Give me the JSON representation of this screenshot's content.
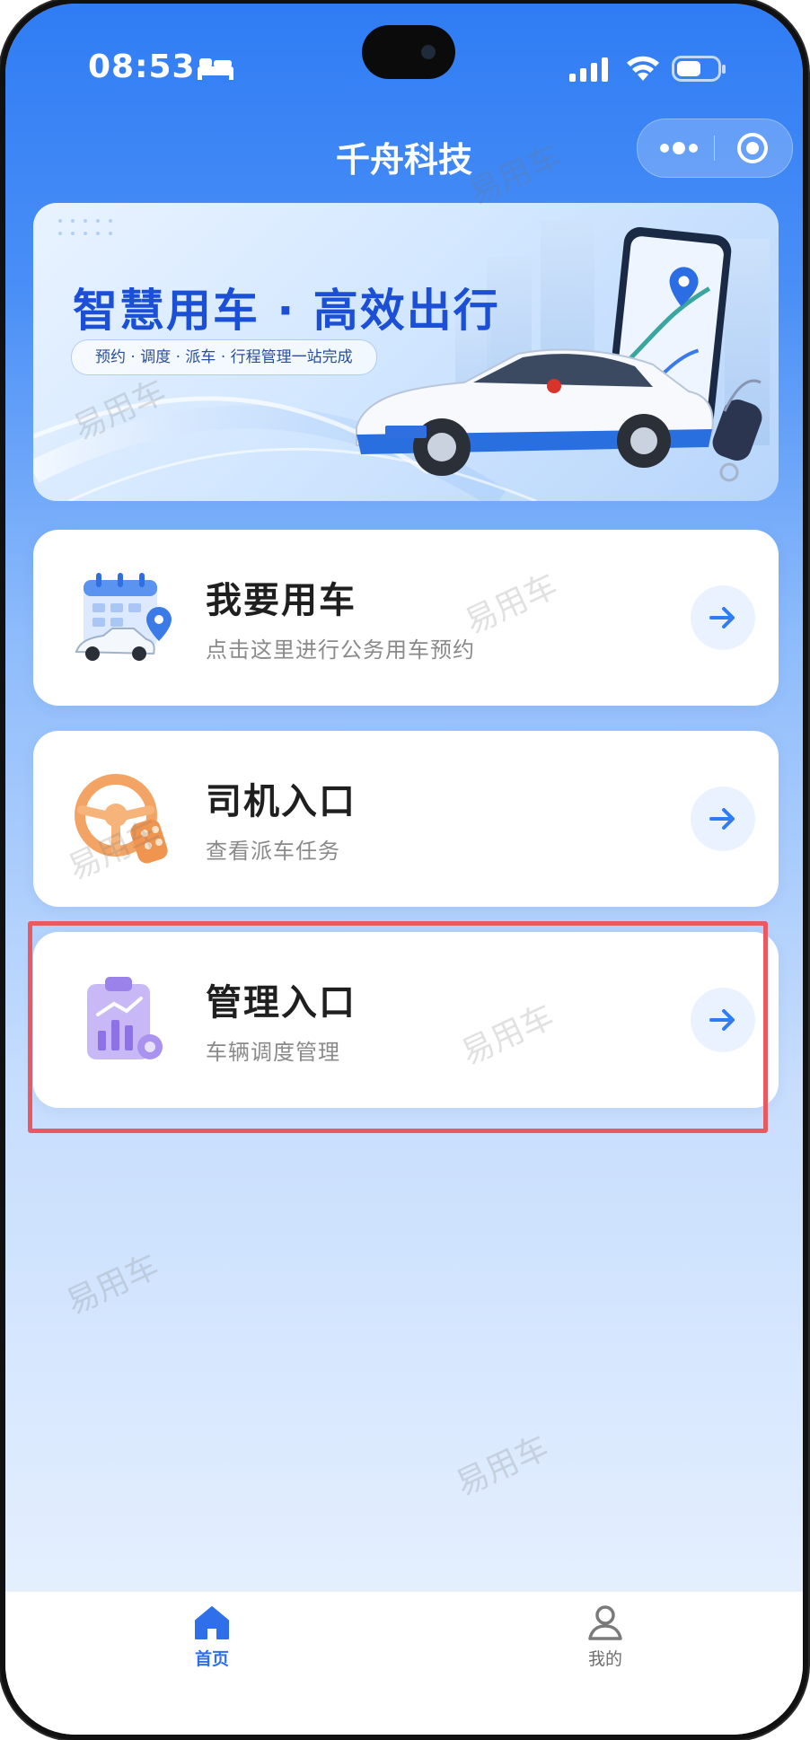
{
  "status_bar": {
    "time": "08:53"
  },
  "nav": {
    "title": "千舟科技"
  },
  "banner": {
    "headline": "智慧用车 · 高效出行",
    "subtitle": "预约 · 调度 · 派车 · 行程管理一站完成"
  },
  "cards": [
    {
      "title": "我要用车",
      "desc": "点击这里进行公务用车预约",
      "icon": "calendar-car-icon"
    },
    {
      "title": "司机入口",
      "desc": "查看派车任务",
      "icon": "steering-wheel-icon"
    },
    {
      "title": "管理入口",
      "desc": "车辆调度管理",
      "icon": "clipboard-chart-icon"
    }
  ],
  "watermark": "易用车",
  "tabbar": {
    "home_label": "首页",
    "mine_label": "我的"
  },
  "colors": {
    "brand_blue": "#2f7cf4",
    "highlight_red": "#e85a5f",
    "active_tab": "#2f6fe9"
  }
}
